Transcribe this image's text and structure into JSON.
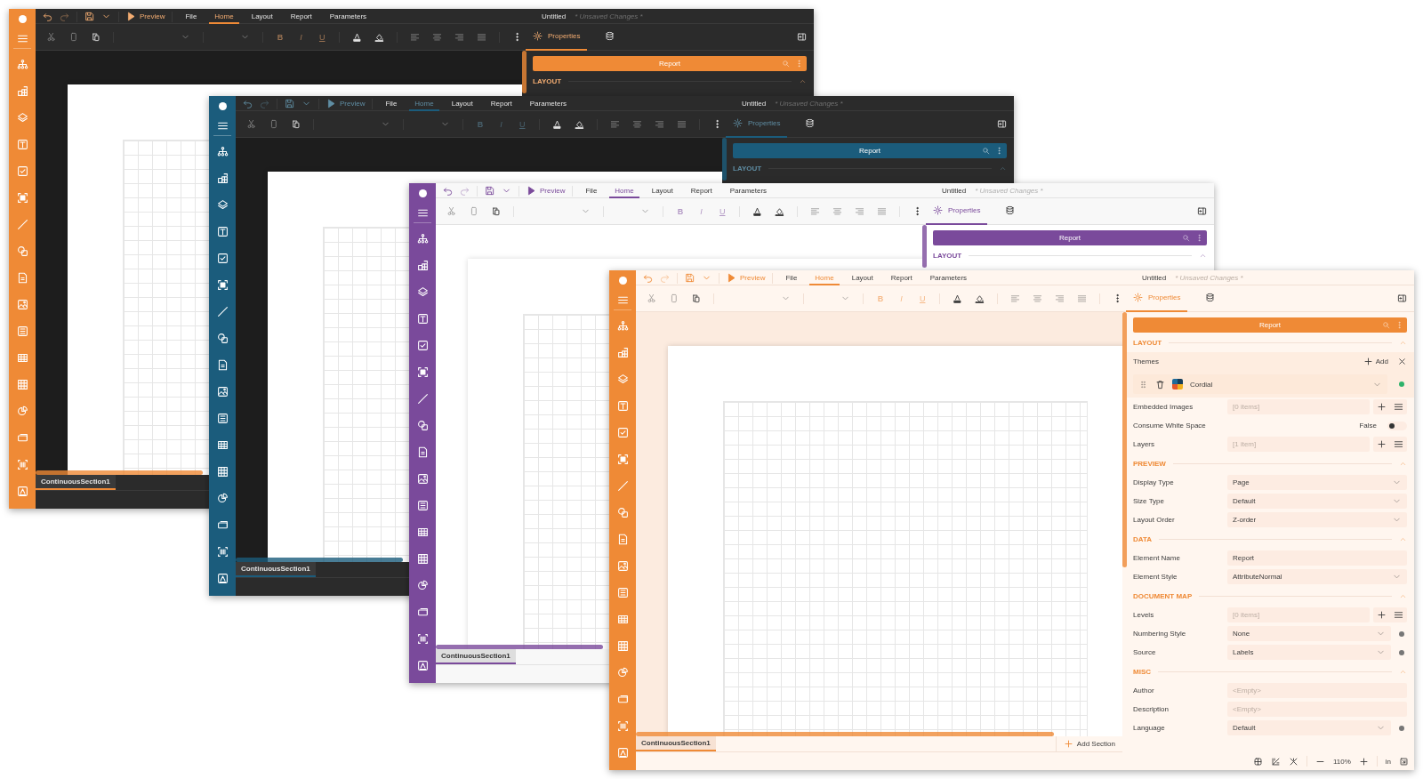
{
  "windows": [
    {
      "kind": "dark",
      "color": "#ef8a36",
      "menu": {
        "preview": "Preview",
        "items": [
          {
            "label": "File",
            "selected": false
          },
          {
            "label": "Home",
            "selected": true
          },
          {
            "label": "Layout",
            "selected": false
          },
          {
            "label": "Report",
            "selected": false
          },
          {
            "label": "Parameters",
            "selected": false
          }
        ]
      },
      "title": "Untitled",
      "status": "* Unsaved Changes *",
      "format_buttons": [
        "B",
        "I",
        "U"
      ],
      "panel_tabs": [
        {
          "kind": "properties",
          "label": "Properties",
          "selected": true
        },
        {
          "kind": "data",
          "selected": false
        }
      ],
      "object": "Report",
      "sections": [
        {
          "title": "LAYOUT",
          "expanded": true
        }
      ],
      "section_tabs": [
        {
          "label": "ContinuousSection1",
          "selected": true
        }
      ]
    },
    {
      "kind": "dark",
      "color": "#1b5c7c",
      "menu": {
        "preview": "Preview",
        "items": [
          {
            "label": "File",
            "selected": false
          },
          {
            "label": "Home",
            "selected": true
          },
          {
            "label": "Layout",
            "selected": false
          },
          {
            "label": "Report",
            "selected": false
          },
          {
            "label": "Parameters",
            "selected": false
          }
        ]
      },
      "title": "Untitled",
      "status": "* Unsaved Changes *",
      "format_buttons": [
        "B",
        "I",
        "U"
      ],
      "panel_tabs": [
        {
          "kind": "properties",
          "label": "Properties",
          "selected": true
        },
        {
          "kind": "data",
          "selected": false
        }
      ],
      "object": "Report",
      "sections": [
        {
          "title": "LAYOUT",
          "expanded": true
        }
      ],
      "section_tabs": [
        {
          "label": "ContinuousSection1",
          "selected": true
        }
      ]
    },
    {
      "kind": "light",
      "color": "#7a4a9b",
      "menu": {
        "preview": "Preview",
        "items": [
          {
            "label": "File",
            "selected": false
          },
          {
            "label": "Home",
            "selected": true
          },
          {
            "label": "Layout",
            "selected": false
          },
          {
            "label": "Report",
            "selected": false
          },
          {
            "label": "Parameters",
            "selected": false
          }
        ]
      },
      "title": "Untitled",
      "status": "* Unsaved Changes *",
      "format_buttons": [
        "B",
        "I",
        "U"
      ],
      "panel_tabs": [
        {
          "kind": "properties",
          "label": "Properties",
          "selected": true
        },
        {
          "kind": "data",
          "selected": false
        }
      ],
      "object": "Report",
      "sections": [
        {
          "title": "LAYOUT",
          "expanded": true
        }
      ],
      "section_tabs": [
        {
          "label": "ContinuousSection1",
          "selected": true
        }
      ]
    },
    {
      "kind": "warm",
      "color": "#ef8a36",
      "menu": {
        "preview": "Preview",
        "items": [
          {
            "label": "File",
            "selected": false
          },
          {
            "label": "Home",
            "selected": true
          },
          {
            "label": "Layout",
            "selected": false
          },
          {
            "label": "Report",
            "selected": false
          },
          {
            "label": "Parameters",
            "selected": false
          }
        ]
      },
      "title": "Untitled",
      "status": "* Unsaved Changes *",
      "format_buttons": [
        "B",
        "I",
        "U"
      ],
      "panel_tabs": [
        {
          "kind": "properties",
          "label": "Properties",
          "selected": true
        },
        {
          "kind": "data",
          "selected": false
        }
      ],
      "object": "Report",
      "sections": [
        {
          "title": "LAYOUT",
          "expanded": true,
          "rows": [
            {
              "kind": "list",
              "label": "Themes",
              "action": "Add"
            },
            {
              "kind": "theme",
              "label": "Cordial",
              "color": "#2fb36b"
            },
            {
              "kind": "collection",
              "label": "Embedded Images",
              "value": "[0 items]"
            },
            {
              "kind": "toggle",
              "label": "Consume White Space",
              "value": "False",
              "on": false
            },
            {
              "kind": "collection",
              "label": "Layers",
              "value": "[1 item]"
            }
          ]
        },
        {
          "title": "PREVIEW",
          "expanded": true,
          "rows": [
            {
              "kind": "dropdown",
              "label": "Display Type",
              "value": "Page",
              "marker": false
            },
            {
              "kind": "dropdown",
              "label": "Size Type",
              "value": "Default",
              "marker": false
            },
            {
              "kind": "dropdown",
              "label": "Layout Order",
              "value": "Z-order",
              "marker": false
            }
          ]
        },
        {
          "title": "DATA",
          "expanded": true,
          "rows": [
            {
              "kind": "text",
              "label": "Element Name",
              "value": "Report"
            },
            {
              "kind": "dropdown",
              "label": "Element Style",
              "value": "AttributeNormal",
              "marker": false
            }
          ]
        },
        {
          "title": "DOCUMENT MAP",
          "expanded": true,
          "rows": [
            {
              "kind": "collection",
              "label": "Levels",
              "value": "[0 items]"
            },
            {
              "kind": "dropdown",
              "label": "Numbering Style",
              "value": "None",
              "marker": true
            },
            {
              "kind": "dropdown",
              "label": "Source",
              "value": "Labels",
              "marker": true
            }
          ]
        },
        {
          "title": "MISC",
          "expanded": true,
          "rows": [
            {
              "kind": "text",
              "label": "Author",
              "placeholder": "<Empty>"
            },
            {
              "kind": "text",
              "label": "Description",
              "placeholder": "<Empty>"
            },
            {
              "kind": "dropdown",
              "label": "Language",
              "value": "Default",
              "marker": true
            }
          ]
        }
      ],
      "section_tabs": [
        {
          "label": "ContinuousSection1",
          "selected": true
        }
      ],
      "add_section": "Add Section",
      "status_bar": {
        "zoom": "110%",
        "unit": "in"
      }
    }
  ]
}
